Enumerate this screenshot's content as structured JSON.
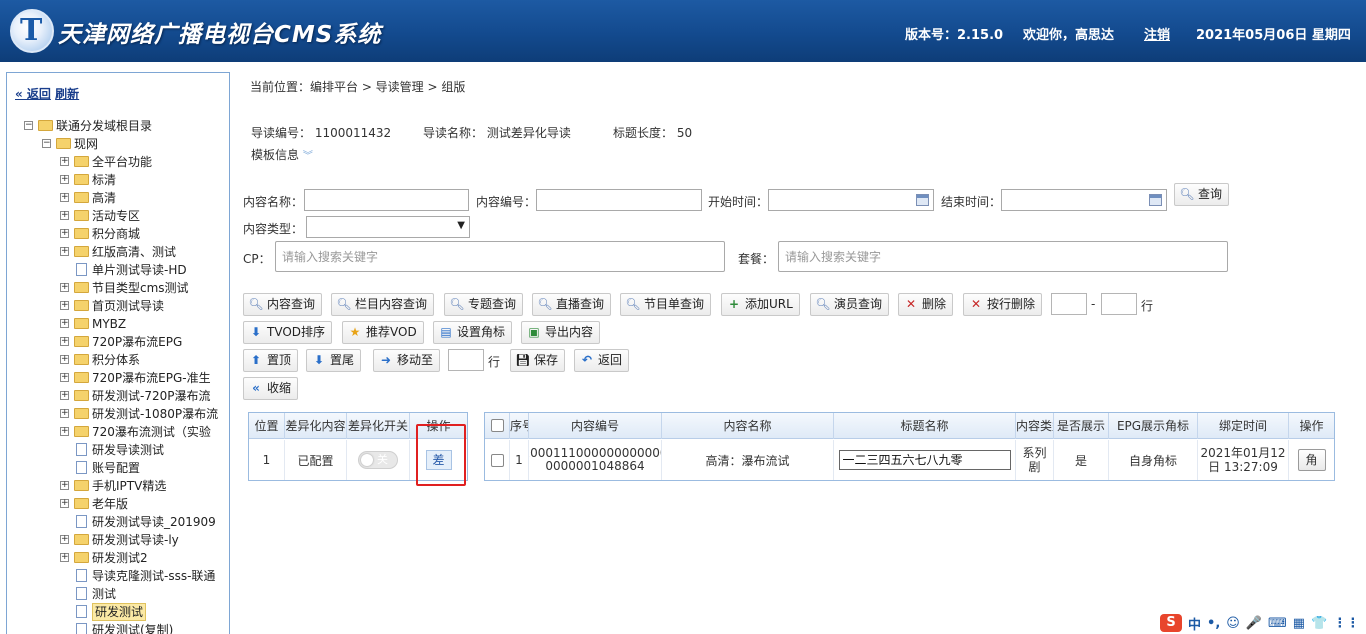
{
  "header": {
    "logo_letter": "T",
    "title": "天津网络广播电视台CMS系统",
    "version": "版本号：2.15.0",
    "welcome": "欢迎你，高思达",
    "logout": "注销",
    "date": "2021年05月06日 星期四"
  },
  "sidebar": {
    "back": "« 返回",
    "refresh": "刷新",
    "tree": [
      {
        "label": "联通分发域根目录",
        "level": 0,
        "toggle": "−",
        "type": "folder"
      },
      {
        "label": "现网",
        "level": 1,
        "toggle": "−",
        "type": "folder"
      },
      {
        "label": "全平台功能",
        "level": 2,
        "toggle": "+",
        "type": "folder"
      },
      {
        "label": "标清",
        "level": 2,
        "toggle": "+",
        "type": "folder"
      },
      {
        "label": "高清",
        "level": 2,
        "toggle": "+",
        "type": "folder"
      },
      {
        "label": "活动专区",
        "level": 2,
        "toggle": "+",
        "type": "folder"
      },
      {
        "label": "积分商城",
        "level": 2,
        "toggle": "+",
        "type": "folder"
      },
      {
        "label": "红版高清、测试",
        "level": 2,
        "toggle": "+",
        "type": "folder"
      },
      {
        "label": "单片测试导读-HD",
        "level": 2,
        "toggle": "",
        "type": "file"
      },
      {
        "label": "节目类型cms测试",
        "level": 2,
        "toggle": "+",
        "type": "folder"
      },
      {
        "label": "首页测试导读",
        "level": 2,
        "toggle": "+",
        "type": "folder"
      },
      {
        "label": "MYBZ",
        "level": 2,
        "toggle": "+",
        "type": "folder"
      },
      {
        "label": "720P瀑布流EPG",
        "level": 2,
        "toggle": "+",
        "type": "folder"
      },
      {
        "label": "积分体系",
        "level": 2,
        "toggle": "+",
        "type": "folder"
      },
      {
        "label": "720P瀑布流EPG-准生",
        "level": 2,
        "toggle": "+",
        "type": "folder"
      },
      {
        "label": "研发测试-720P瀑布流",
        "level": 2,
        "toggle": "+",
        "type": "folder"
      },
      {
        "label": "研发测试-1080P瀑布流",
        "level": 2,
        "toggle": "+",
        "type": "folder"
      },
      {
        "label": "720瀑布流测试（实验",
        "level": 2,
        "toggle": "+",
        "type": "folder"
      },
      {
        "label": "研发导读测试",
        "level": 2,
        "toggle": "",
        "type": "file"
      },
      {
        "label": "账号配置",
        "level": 2,
        "toggle": "",
        "type": "file"
      },
      {
        "label": "手机IPTV精选",
        "level": 2,
        "toggle": "+",
        "type": "folder"
      },
      {
        "label": "老年版",
        "level": 2,
        "toggle": "+",
        "type": "folder"
      },
      {
        "label": "研发测试导读_201909",
        "level": 2,
        "toggle": "",
        "type": "file"
      },
      {
        "label": "研发测试导读-ly",
        "level": 2,
        "toggle": "+",
        "type": "folder"
      },
      {
        "label": "研发测试2",
        "level": 2,
        "toggle": "+",
        "type": "folder"
      },
      {
        "label": "导读克隆测试-sss-联通",
        "level": 2,
        "toggle": "",
        "type": "file"
      },
      {
        "label": "测试",
        "level": 2,
        "toggle": "",
        "type": "file"
      },
      {
        "label": "研发测试",
        "level": 2,
        "toggle": "",
        "type": "file",
        "selected": true
      },
      {
        "label": "研发测试(复制)",
        "level": 2,
        "toggle": "",
        "type": "file"
      }
    ]
  },
  "main": {
    "breadcrumb": "当前位置：编排平台 > 导读管理 > 组版",
    "guide_id": "导读编号： 1100011432",
    "guide_name": "导读名称： 测试差异化导读",
    "title_length": "标题长度： 50",
    "template_info": "模板信息",
    "template_chevron": "︾",
    "filters": {
      "content_name_label": "内容名称：",
      "content_id_label": "内容编号：",
      "start_time_label": "开始时间：",
      "end_time_label": "结束时间：",
      "search": "查询",
      "content_type_label": "内容类型：",
      "content_type_value": "",
      "cp_label": "CP：",
      "cp_placeholder": "请输入搜索关键字",
      "package_label": "套餐：",
      "package_placeholder": "请输入搜索关键字"
    },
    "toolbar": {
      "content_query": "内容查询",
      "column_query": "栏目内容查询",
      "topic_query": "专题查询",
      "live_query": "直播查询",
      "program_query": "节目单查询",
      "add_url": "添加URL",
      "actor_query": "演员查询",
      "delete": "删除",
      "delete_by_row": "按行删除",
      "dash": "-",
      "row_unit": "行",
      "tvod_sort": "TVOD排序",
      "recommend_vod": "推荐VOD",
      "set_corner": "设置角标",
      "export": "导出内容",
      "to_top": "置顶",
      "to_bottom": "置尾",
      "move_to": "移动至",
      "row_unit2": "行",
      "save": "保存",
      "back": "返回",
      "collapse": "收缩"
    },
    "left_grid": {
      "headers": [
        "位置",
        "差异化内容",
        "差异化开关",
        "操作"
      ],
      "row": {
        "position": "1",
        "status": "已配置",
        "switch_text": "关",
        "op": "差"
      }
    },
    "right_grid": {
      "headers": [
        "序号",
        "内容编号",
        "内容名称",
        "标题名称",
        "内容类型",
        "是否展示",
        "EPG展示角标",
        "绑定时间",
        "操作"
      ],
      "row": {
        "seq": "1",
        "content_id_1": "1000111000000000000",
        "content_id_2": "0000001048864",
        "content_name": "高清：瀑布流试",
        "title": "一二三四五六七八九零",
        "type_1": "系列",
        "type_2": "剧",
        "display": "是",
        "corner": "自身角标",
        "bind_1": "2021年01月12",
        "bind_2": "日 13:27:09",
        "op": "角"
      }
    }
  },
  "ime": {
    "logo": "S",
    "lang": "中",
    "punct": "•,",
    "emoji": "☺",
    "voice": "🎤",
    "keyboard": "⌨",
    "tool": "▦",
    "skin": "👕",
    "more": "⋮⋮"
  }
}
